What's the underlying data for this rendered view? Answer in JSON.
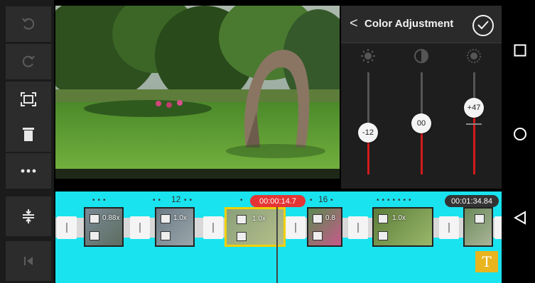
{
  "toolbar": {
    "items": [
      {
        "icon": "undo-icon",
        "enabled": false
      },
      {
        "icon": "redo-icon",
        "enabled": false
      },
      {
        "icon": "crop-frame-icon",
        "enabled": true
      },
      {
        "icon": "trash-icon",
        "enabled": true
      },
      {
        "icon": "more-horizontal-icon",
        "enabled": true
      }
    ],
    "bottom_items": [
      {
        "icon": "adjust-tracks-icon"
      },
      {
        "icon": "skip-to-start-icon"
      }
    ]
  },
  "panel": {
    "title": "Color Adjustment",
    "back_icon": "<",
    "sliders": [
      {
        "icon": "brightness-icon",
        "value": -12,
        "label": "-12"
      },
      {
        "icon": "contrast-icon",
        "value": 0,
        "label": "00"
      },
      {
        "icon": "saturation-icon",
        "value": 47,
        "label": "+47"
      }
    ]
  },
  "timeline": {
    "current_time": "00:00:14.7",
    "total_time": "00:01:34.84",
    "markers": [
      "12",
      "16"
    ],
    "clips": [
      {
        "speed": "0.88x"
      },
      {
        "speed": "1.0x"
      },
      {
        "speed": "1.0x",
        "selected": true
      },
      {
        "speed": "0.8"
      },
      {
        "speed": "1.0x"
      },
      {
        "speed": ""
      }
    ],
    "text_badge": "T"
  },
  "colors": {
    "accent_red": "#d21a1a",
    "timeline_bg": "#19e3ef",
    "selected_clip": "#f0d000"
  }
}
